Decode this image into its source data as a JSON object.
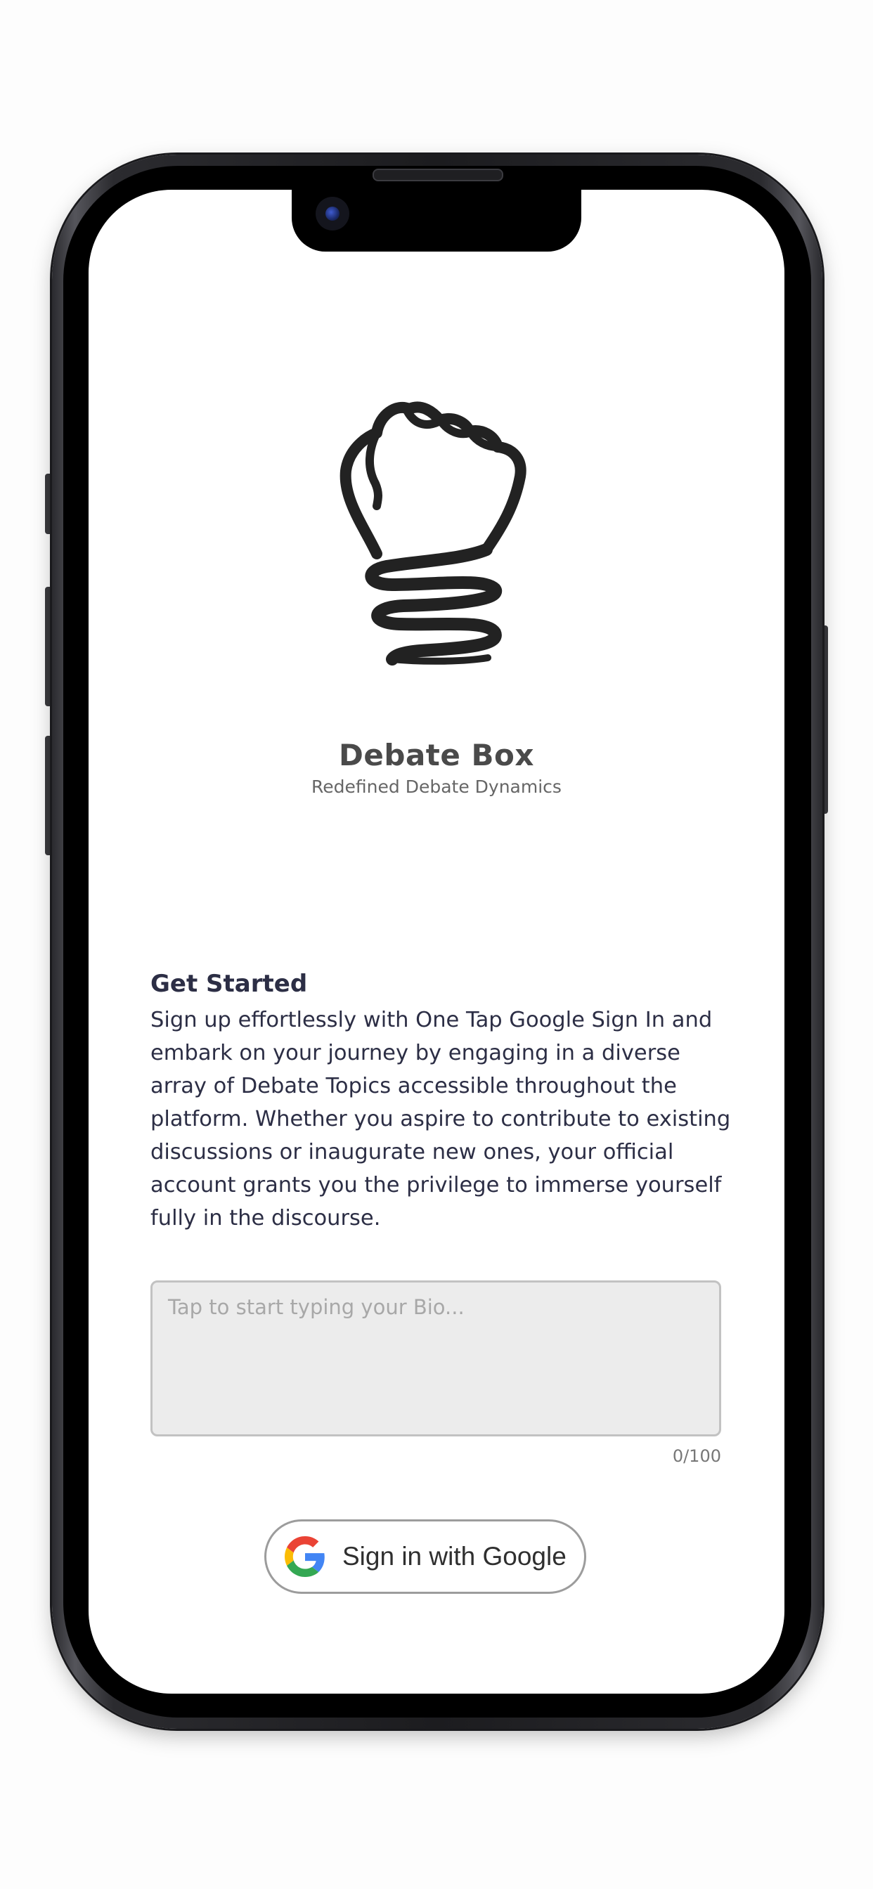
{
  "app": {
    "name": "Debate Box",
    "tagline": "Redefined Debate Dynamics"
  },
  "intro": {
    "title": "Get Started",
    "body": "Sign up effortlessly with One Tap Google Sign In and embark on your journey by engaging in a diverse array of Debate Topics accessible throughout the platform. Whether you aspire to contribute to existing discussions or inaugurate new ones, your official account grants you the privilege to immerse yourself fully in the discourse."
  },
  "bio_input": {
    "value": "",
    "placeholder": "Tap to start typing your Bio...",
    "counter": "0/100"
  },
  "signin_button": {
    "label": "Sign in with Google",
    "icon": "google-g-icon"
  },
  "logo": {
    "icon": "fist-lightbulb-icon",
    "color": "#222222"
  },
  "colors": {
    "text_dark": "#2c2e45",
    "title_gray": "#4a4a4a",
    "input_bg": "#ececec",
    "google_blue": "#4285F4",
    "google_red": "#EA4335",
    "google_yellow": "#FBBC05",
    "google_green": "#34A853"
  }
}
